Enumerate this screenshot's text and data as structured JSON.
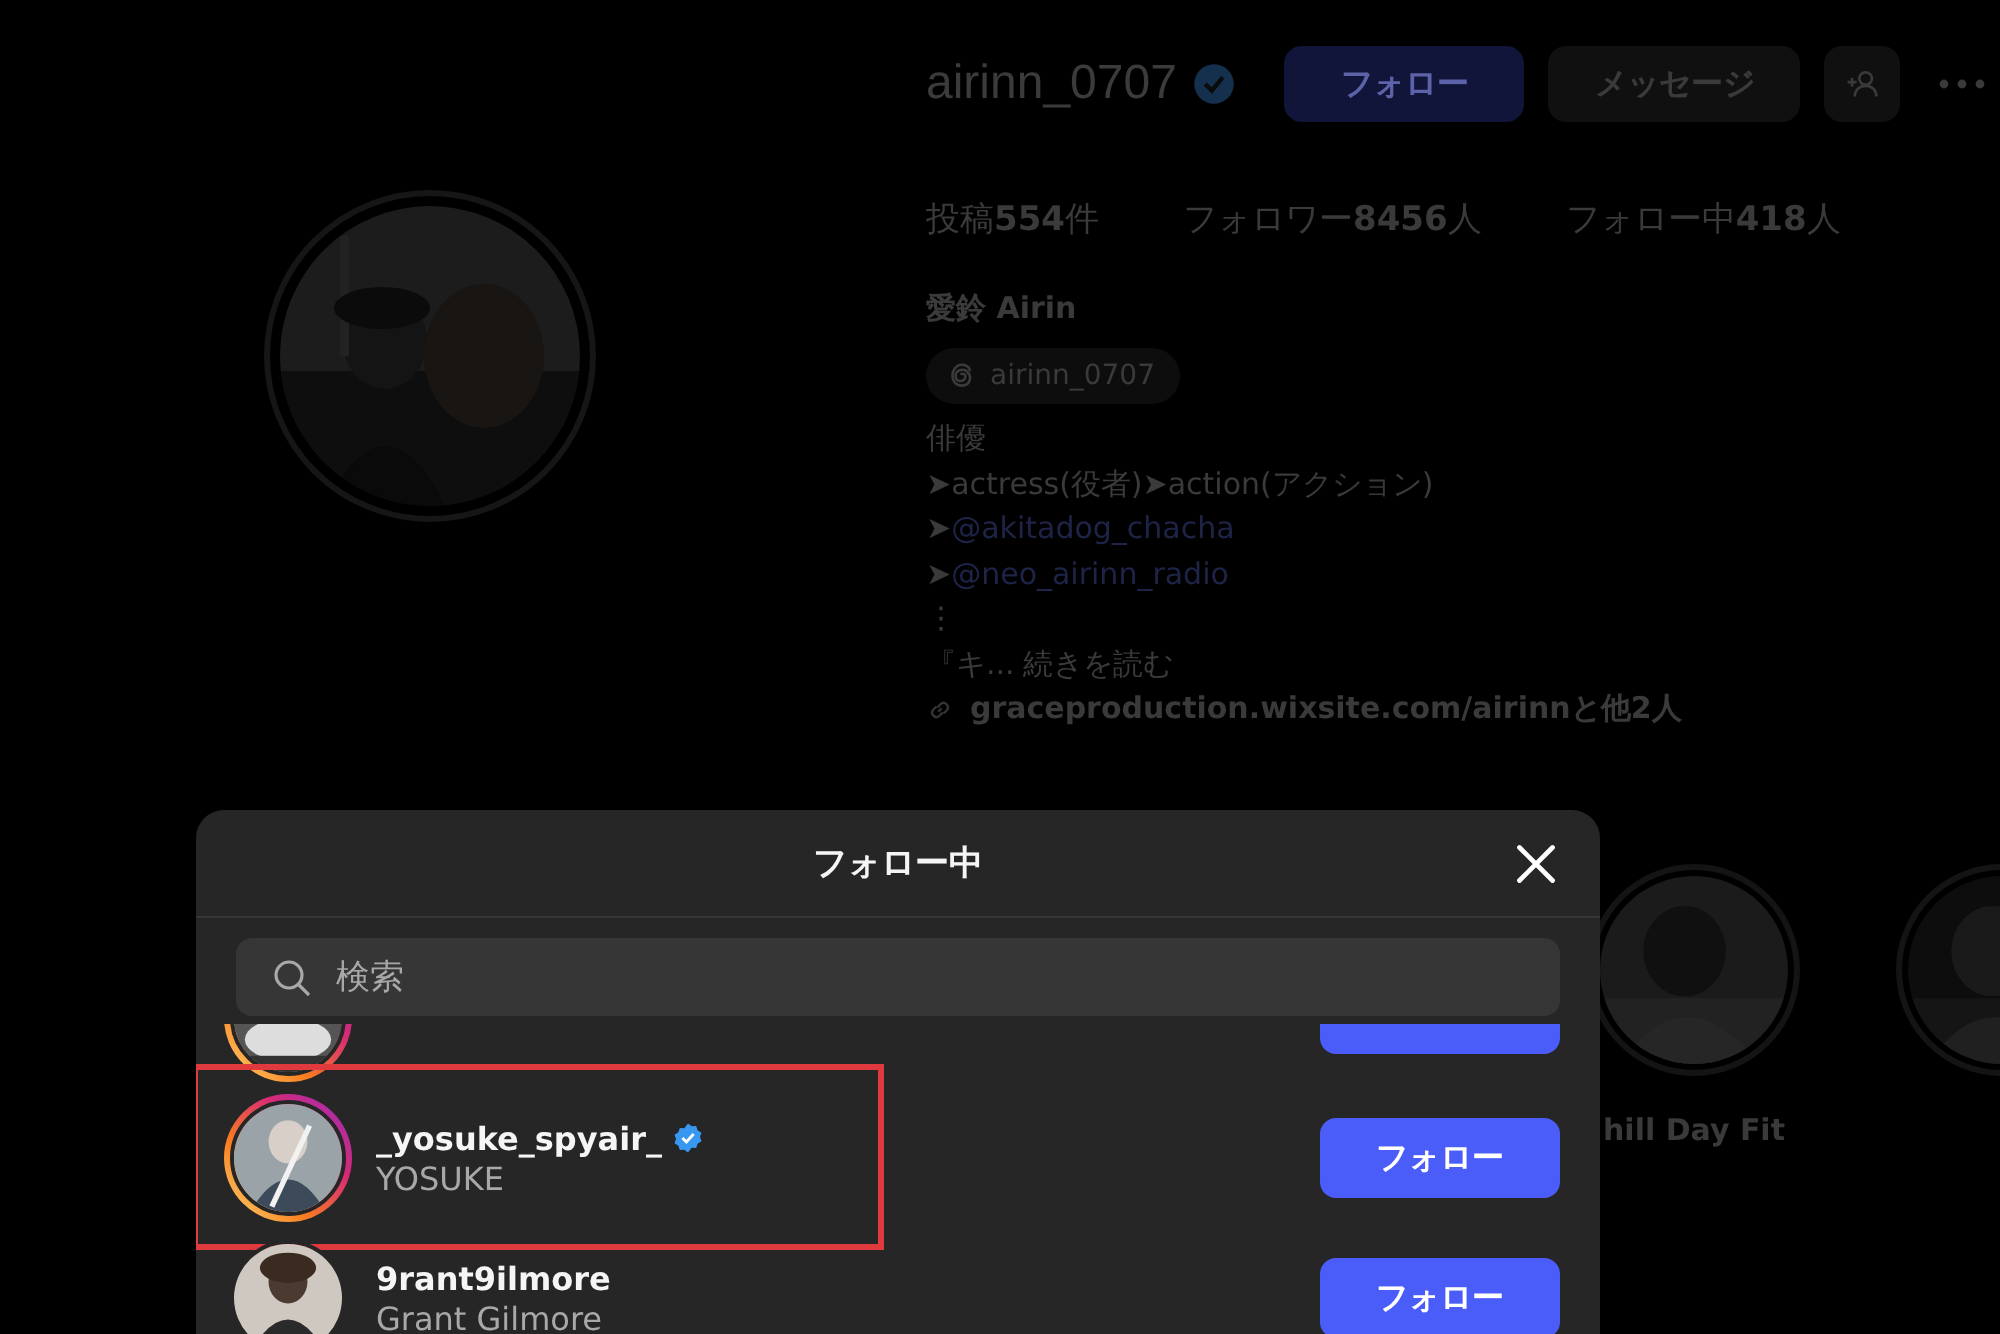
{
  "profile": {
    "username": "airinn_0707",
    "verified": true,
    "buttons": [
      {
        "label": "フォロー",
        "kind": "primary"
      },
      {
        "label": "メッセージ",
        "kind": "secondary"
      }
    ],
    "stats": [
      {
        "label": "投稿",
        "count": "554",
        "unit": "件"
      },
      {
        "label": "フォロワー",
        "count": "8456",
        "unit": "人"
      },
      {
        "label": "フォロー中",
        "count": "418",
        "unit": "人"
      }
    ],
    "display_name": "愛鈴 Airin",
    "threads_handle": "airinn_0707",
    "bio": [
      {
        "kind": "text",
        "text": "俳優"
      },
      {
        "kind": "text",
        "text": "➤actress(役者)➤action(アクション)"
      },
      {
        "kind": "mention",
        "prefix": "➤",
        "text": "@akitadog_chacha"
      },
      {
        "kind": "mention",
        "prefix": "➤",
        "text": "@neo_airinn_radio"
      },
      {
        "kind": "text",
        "text": "⋮"
      },
      {
        "kind": "more",
        "text": "『キ...",
        "more": "続きを読む"
      }
    ],
    "link": "graceproduction.wixsite.com/airinnと他2人",
    "highlights": [
      {
        "kind": "picture",
        "title": "hill Day Fit"
      },
      {
        "kind": "picture"
      }
    ]
  },
  "modal": {
    "title": "フォロー中",
    "search": {
      "placeholder": "検索"
    },
    "rows": [
      {
        "username": "_yosuke_spyair_",
        "name": "YOSUKE",
        "verified": true,
        "story_ring": true,
        "highlighted": true,
        "button": "フォロー"
      },
      {
        "username": "9rant9ilmore",
        "name": "Grant Gilmore",
        "verified": false,
        "story_ring": false,
        "highlighted": false,
        "button": "フォロー"
      }
    ]
  }
}
